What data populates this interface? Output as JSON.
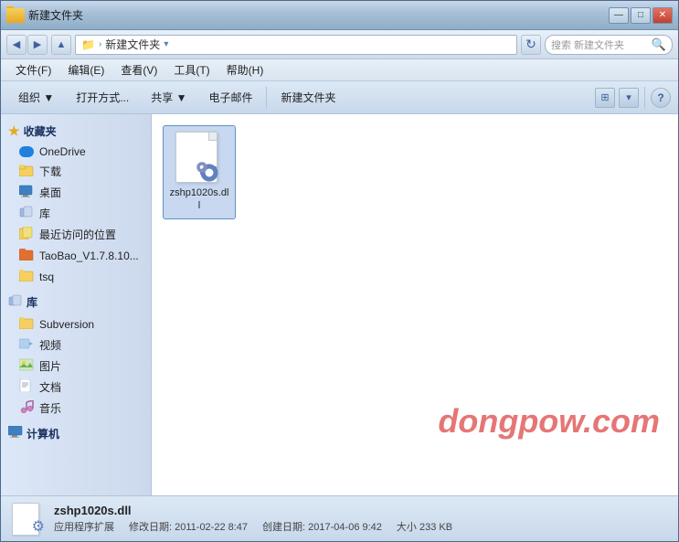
{
  "window": {
    "title": "新建文件夹",
    "controls": {
      "minimize": "—",
      "maximize": "□",
      "close": "✕"
    }
  },
  "addressbar": {
    "breadcrumb": "新建文件夹",
    "search_placeholder": "搜索 新建文件夹"
  },
  "menubar": {
    "items": [
      {
        "label": "文件(F)"
      },
      {
        "label": "编辑(E)"
      },
      {
        "label": "查看(V)"
      },
      {
        "label": "工具(T)"
      },
      {
        "label": "帮助(H)"
      }
    ]
  },
  "toolbar": {
    "organize": "组织 ▼",
    "open_with": "打开方式...",
    "share": "共享 ▼",
    "email": "电子邮件",
    "new_folder": "新建文件夹",
    "view_icon": "⊞",
    "help_icon": "?"
  },
  "sidebar": {
    "favorites_header": "收藏夹",
    "items_favorites": [
      {
        "label": "OneDrive",
        "icon": "onedrive"
      },
      {
        "label": "下载",
        "icon": "folder"
      },
      {
        "label": "桌面",
        "icon": "desktop"
      },
      {
        "label": "库",
        "icon": "lib"
      },
      {
        "label": "最近访问的位置",
        "icon": "recent"
      },
      {
        "label": "TaoBao_V1.7.8.10...",
        "icon": "taobao"
      },
      {
        "label": "tsq",
        "icon": "folder"
      }
    ],
    "library_header": "库",
    "items_library": [
      {
        "label": "Subversion",
        "icon": "folder"
      },
      {
        "label": "视频",
        "icon": "video"
      },
      {
        "label": "图片",
        "icon": "picture"
      },
      {
        "label": "文档",
        "icon": "doc"
      },
      {
        "label": "音乐",
        "icon": "music"
      }
    ],
    "computer_header": "计算机"
  },
  "files": [
    {
      "name": "zshp1020s.dll",
      "icon": "dll"
    }
  ],
  "statusbar": {
    "filename": "zshp1020s.dll",
    "modified_label": "修改日期:",
    "modified_date": "2011-02-22 8:47",
    "created_label": "创建日期:",
    "created_date": "2017-04-06 9:42",
    "type": "应用程序扩展",
    "size_label": "大小",
    "size": "233 KB"
  },
  "watermark": "dongpow.com"
}
